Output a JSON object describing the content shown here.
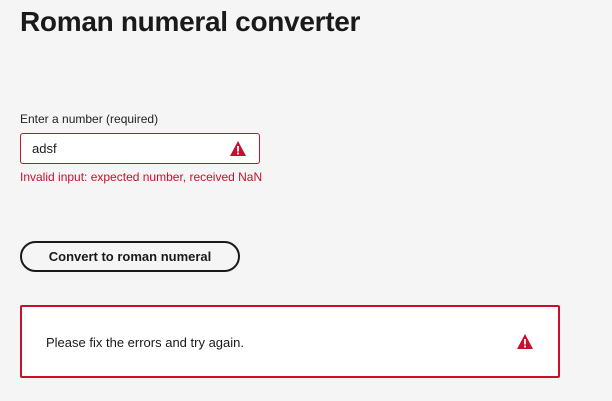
{
  "page": {
    "title": "Roman numeral converter"
  },
  "form": {
    "number_field": {
      "label": "Enter a number (required)",
      "value": "adsf",
      "error": "Invalid input: expected number, received NaN",
      "status_icon": "warning-triangle-icon"
    },
    "convert_button_label": "Convert to roman numeral"
  },
  "alert": {
    "message": "Please fix the errors and try again.",
    "icon": "warning-triangle-icon"
  },
  "colors": {
    "error": "#c8102e",
    "background": "#f5f5f5",
    "text": "#1a1a1a"
  }
}
